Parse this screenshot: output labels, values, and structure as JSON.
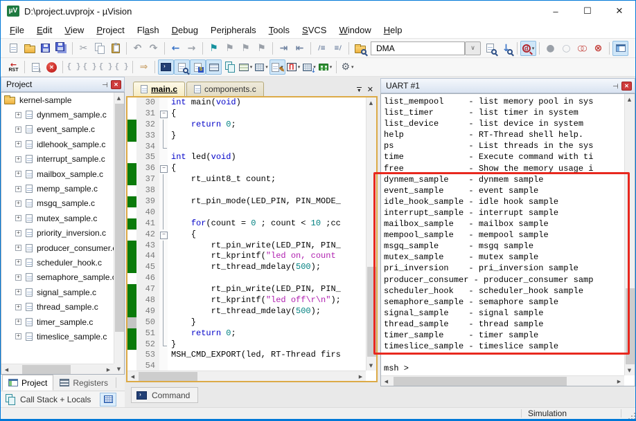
{
  "window": {
    "title": "D:\\project.uvprojx - µVision",
    "controls": {
      "minimize": "–",
      "maximize": "☐",
      "close": "✕"
    }
  },
  "menu": {
    "items": [
      {
        "label": "File",
        "key": 0
      },
      {
        "label": "Edit",
        "key": 0
      },
      {
        "label": "View",
        "key": 0
      },
      {
        "label": "Project",
        "key": 0
      },
      {
        "label": "Flash",
        "key": 2
      },
      {
        "label": "Debug",
        "key": 0
      },
      {
        "label": "Peripherals",
        "key": 3
      },
      {
        "label": "Tools",
        "key": 0
      },
      {
        "label": "SVCS",
        "key": 0
      },
      {
        "label": "Window",
        "key": 0
      },
      {
        "label": "Help",
        "key": 0
      }
    ]
  },
  "toolbar1": {
    "find_value": "DMA",
    "items": [
      {
        "name": "new-file-button",
        "icon": "page"
      },
      {
        "name": "open-file-button",
        "icon": "folder"
      },
      {
        "name": "save-button",
        "icon": "floppy"
      },
      {
        "name": "save-all-button",
        "icon": "floppy2"
      },
      {
        "sep": true
      },
      {
        "name": "cut-button",
        "icon": "scissors"
      },
      {
        "name": "copy-button",
        "icon": "copy"
      },
      {
        "name": "paste-button",
        "icon": "paste"
      },
      {
        "sep": true
      },
      {
        "name": "undo-button",
        "icon": "undo"
      },
      {
        "name": "redo-button",
        "icon": "redo"
      },
      {
        "sep": true
      },
      {
        "name": "navigate-back-button",
        "icon": "back"
      },
      {
        "name": "navigate-forward-button",
        "icon": "fwd"
      },
      {
        "sep": true
      },
      {
        "name": "insert-bookmark-button",
        "icon": "flag"
      },
      {
        "name": "next-bookmark-button",
        "icon": "flagg"
      },
      {
        "name": "prev-bookmark-button",
        "icon": "flagg"
      },
      {
        "name": "clear-bookmarks-button",
        "icon": "flagg"
      },
      {
        "sep": true
      },
      {
        "name": "indent-button",
        "icon": "indent"
      },
      {
        "name": "unindent-button",
        "icon": "outdent"
      },
      {
        "sep": true
      },
      {
        "name": "comment-button",
        "icon": "comment"
      },
      {
        "name": "uncomment-button",
        "icon": "uncomment"
      },
      {
        "sep": true
      },
      {
        "name": "find-in-files-button",
        "icon": "folderfind"
      },
      {
        "name": "find-target-combo",
        "combo": true
      },
      {
        "name": "find-combo-dropdown",
        "icon": "ddbox"
      },
      {
        "name": "find-in-files-dialog-button",
        "icon": "docmag"
      },
      {
        "name": "incremental-find-button",
        "icon": "downmag"
      },
      {
        "sep": true
      },
      {
        "name": "find-definition-button",
        "icon": "dmag",
        "hl": true,
        "dd": true
      },
      {
        "sep": true
      },
      {
        "name": "toggle-breakpoint-button",
        "icon": "cfill"
      },
      {
        "name": "disable-breakpoint-button",
        "icon": "cout"
      },
      {
        "name": "disable-all-breakpoints-button",
        "icon": "c2red"
      },
      {
        "name": "kill-all-breakpoints-button",
        "icon": "credx"
      },
      {
        "sep": true
      },
      {
        "name": "project-windows-button",
        "icon": "win",
        "hl": true
      }
    ]
  },
  "toolbar2": {
    "reset_label": "RST",
    "items": [
      {
        "name": "reset-button",
        "icon": "rst"
      },
      {
        "sep": true
      },
      {
        "name": "show-next-statement-button",
        "icon": "docrun"
      },
      {
        "name": "stop-debug-button",
        "icon": "stop"
      },
      {
        "sep": true
      },
      {
        "name": "step-into-button",
        "icon": "step"
      },
      {
        "name": "step-over-button",
        "icon": "step"
      },
      {
        "name": "step-out-button",
        "icon": "step"
      },
      {
        "name": "run-to-line-button",
        "icon": "step"
      },
      {
        "sep": true
      },
      {
        "name": "run-button",
        "icon": "runarrow"
      },
      {
        "sep": true
      },
      {
        "name": "command-window-button",
        "icon": "term",
        "hl": true
      },
      {
        "name": "disassembly-window-button",
        "icon": "docmag",
        "hl": true
      },
      {
        "name": "symbol-window-button",
        "icon": "sym",
        "hl": true
      },
      {
        "name": "registers-window-button",
        "icon": "rows",
        "hl": true
      },
      {
        "name": "callstack-window-button",
        "icon": "stack"
      },
      {
        "name": "watch-window-button",
        "icon": "watch",
        "dd": true
      },
      {
        "name": "memory-window-button",
        "icon": "mem",
        "dd": true
      },
      {
        "name": "serial-window-button",
        "icon": "serial",
        "hl": true,
        "dd": true
      },
      {
        "name": "logic-analyzer-button",
        "icon": "wave",
        "dd": true
      },
      {
        "name": "system-viewer-button",
        "icon": "sysv",
        "dd": true
      },
      {
        "name": "toolbox-button",
        "icon": "toolbox",
        "dd": true
      },
      {
        "sep": true
      },
      {
        "name": "debug-tools-button",
        "icon": "tools",
        "dd": true
      }
    ]
  },
  "project_panel": {
    "title": "Project",
    "root": "kernel-sample",
    "files": [
      "dynmem_sample.c",
      "event_sample.c",
      "idlehook_sample.c",
      "interrupt_sample.c",
      "mailbox_sample.c",
      "memp_sample.c",
      "msgq_sample.c",
      "mutex_sample.c",
      "priority_inversion.c",
      "producer_consumer.c",
      "scheduler_hook.c",
      "semaphore_sample.c",
      "signal_sample.c",
      "thread_sample.c",
      "timer_sample.c",
      "timeslice_sample.c"
    ]
  },
  "bottom_tabs": {
    "project": "Project",
    "registers": "Registers",
    "callstack": "Call Stack + Locals"
  },
  "editor": {
    "tabs": [
      {
        "label": "main.c",
        "active": true
      },
      {
        "label": "components.c",
        "active": false
      }
    ],
    "command_tab": "Command",
    "lines": [
      {
        "n": 30,
        "seg": [
          [
            "int",
            "k"
          ],
          [
            " main(",
            "p"
          ],
          [
            "void",
            "k"
          ],
          [
            ")",
            "p"
          ]
        ]
      },
      {
        "n": 31,
        "fold": "fb",
        "seg": [
          [
            "{",
            "p"
          ]
        ]
      },
      {
        "n": 32,
        "fold": "fv",
        "green": 1,
        "seg": [
          [
            "    ",
            "p"
          ],
          [
            "return",
            "k"
          ],
          [
            " ",
            "p"
          ],
          [
            "0",
            "n"
          ],
          [
            ";",
            "p"
          ]
        ]
      },
      {
        "n": 33,
        "fold": "fv",
        "green": 1,
        "seg": [
          [
            "}",
            "p"
          ]
        ]
      },
      {
        "n": 34,
        "fold": "fe",
        "seg": []
      },
      {
        "n": 35,
        "seg": [
          [
            "int",
            "k"
          ],
          [
            " led(",
            "p"
          ],
          [
            "void",
            "k"
          ],
          [
            ")",
            "p"
          ]
        ]
      },
      {
        "n": 36,
        "fold": "fb",
        "green": 1,
        "seg": [
          [
            "{",
            "p"
          ]
        ]
      },
      {
        "n": 37,
        "fold": "fv",
        "green": 1,
        "seg": [
          [
            "    rt_uint8_t count;",
            "p"
          ]
        ]
      },
      {
        "n": 38,
        "fold": "fv",
        "seg": []
      },
      {
        "n": 39,
        "fold": "fv",
        "green": 1,
        "seg": [
          [
            "    rt_pin_mode(LED_PIN, PIN_MODE_",
            "p"
          ]
        ]
      },
      {
        "n": 40,
        "fold": "fv",
        "seg": []
      },
      {
        "n": 41,
        "fold": "fv",
        "green": 1,
        "seg": [
          [
            "    ",
            "p"
          ],
          [
            "for",
            "k"
          ],
          [
            "(count = ",
            "p"
          ],
          [
            "0",
            "n"
          ],
          [
            " ; count < ",
            "p"
          ],
          [
            "10",
            "n"
          ],
          [
            " ;cc",
            "p"
          ]
        ]
      },
      {
        "n": 42,
        "fold": "fb",
        "seg": [
          [
            "    {",
            "p"
          ]
        ]
      },
      {
        "n": 43,
        "fold": "fv",
        "green": 1,
        "seg": [
          [
            "        rt_pin_write(LED_PIN, PIN_",
            "p"
          ]
        ]
      },
      {
        "n": 44,
        "fold": "fv",
        "green": 1,
        "seg": [
          [
            "        rt_kprintf(",
            "p"
          ],
          [
            "\"led on, count",
            "s"
          ]
        ]
      },
      {
        "n": 45,
        "fold": "fv",
        "green": 1,
        "seg": [
          [
            "        rt_thread_mdelay(",
            "p"
          ],
          [
            "500",
            "n"
          ],
          [
            ");",
            "p"
          ]
        ]
      },
      {
        "n": 46,
        "fold": "fv",
        "seg": []
      },
      {
        "n": 47,
        "fold": "fv",
        "green": 1,
        "seg": [
          [
            "        rt_pin_write(LED_PIN, PIN_",
            "p"
          ]
        ]
      },
      {
        "n": 48,
        "fold": "fv",
        "green": 1,
        "seg": [
          [
            "        rt_kprintf(",
            "p"
          ],
          [
            "\"led off\\r\\n\"",
            "s"
          ],
          [
            ");",
            "p"
          ]
        ]
      },
      {
        "n": 49,
        "fold": "fv",
        "green": 1,
        "seg": [
          [
            "        rt_thread_mdelay(",
            "p"
          ],
          [
            "500",
            "n"
          ],
          [
            ");",
            "p"
          ]
        ]
      },
      {
        "n": 50,
        "fold": "fv",
        "gray": 1,
        "seg": [
          [
            "    }",
            "p"
          ]
        ]
      },
      {
        "n": 51,
        "fold": "fv",
        "green": 1,
        "seg": [
          [
            "    ",
            "p"
          ],
          [
            "return",
            "k"
          ],
          [
            " ",
            "p"
          ],
          [
            "0",
            "n"
          ],
          [
            ";",
            "p"
          ]
        ]
      },
      {
        "n": 52,
        "fold": "fe",
        "green": 1,
        "seg": [
          [
            "}",
            "p"
          ]
        ]
      },
      {
        "n": 53,
        "seg": [
          [
            "MSH_CMD_EXPORT(led, RT-Thread firs",
            "p"
          ]
        ]
      },
      {
        "n": 54,
        "seg": []
      }
    ]
  },
  "uart_panel": {
    "title": "UART #1",
    "lines": [
      "list_mempool     - list memory pool in sys",
      "list_timer       - list timer in system",
      "list_device      - list device in system",
      "help             - RT-Thread shell help.",
      "ps               - List threads in the sys",
      "time             - Execute command with ti",
      "free             - Show the memory usage i",
      "dynmem_sample    - dynmem sample",
      "event_sample     - event sample",
      "idle_hook_sample - idle hook sample",
      "interrupt_sample - interrupt sample",
      "mailbox_sample   - mailbox sample",
      "mempool_sample   - mempool sample",
      "msgq_sample      - msgq sample",
      "mutex_sample     - mutex sample",
      "pri_inversion    - pri_inversion sample",
      "producer_consumer - producer_consumer samp",
      "scheduler_hook   - scheduler_hook sample",
      "semaphore_sample - semaphore sample",
      "signal_sample    - signal sample",
      "thread_sample    - thread sample",
      "timer_sample     - timer sample",
      "timeslice_sample - timeslice sample",
      "",
      "msh >"
    ]
  },
  "status_bar": {
    "mode": "Simulation"
  }
}
